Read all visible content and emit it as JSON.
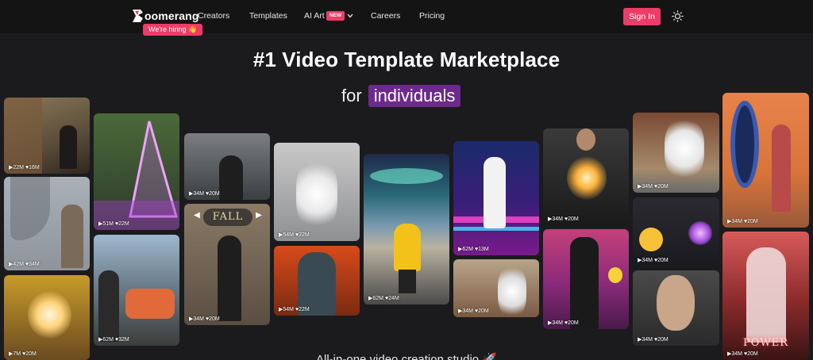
{
  "brand": {
    "name": "oomerang",
    "hiring_label": "We're hiring 👋"
  },
  "nav": {
    "creators": "Creators",
    "templates": "Templates",
    "ai_art": "AI Art",
    "ai_art_badge": "NEW",
    "careers": "Careers",
    "pricing": "Pricing",
    "sign_in": "Sign In"
  },
  "icons": {
    "logo": "boomerang-logo-icon",
    "ai_art_dropdown": "chevron-down-icon",
    "theme_toggle": "sun-icon",
    "play": "play-icon",
    "heart": "heart-icon",
    "carousel_prev": "chevron-left-icon",
    "carousel_next": "chevron-right-icon"
  },
  "hero": {
    "title": "#1 Video Template Marketplace",
    "sub_prefix": "for",
    "sub_highlight": "individuals",
    "tagline": "All-in-one video creation studio 🚀"
  },
  "colors": {
    "accent": "#ef3b67",
    "highlight": "#6d2a8c",
    "background": "#1b1b1d"
  },
  "cards": [
    {
      "views": "22M",
      "likes": "16M"
    },
    {
      "views": "42M",
      "likes": "34M"
    },
    {
      "views": "7M",
      "likes": "20M"
    },
    {
      "views": "51M",
      "likes": "22M"
    },
    {
      "views": "62M",
      "likes": "32M"
    },
    {
      "views": "34M",
      "likes": "20M"
    },
    {
      "label": "FALL",
      "views": "34M",
      "likes": "20M"
    },
    {
      "views": "54M",
      "likes": "22M"
    },
    {
      "views": "54M",
      "likes": "22M"
    },
    {
      "views": "62M",
      "likes": "24M"
    },
    {
      "views": "62M",
      "likes": "13M"
    },
    {
      "views": "34M",
      "likes": "20M"
    },
    {
      "views": "34M",
      "likes": "20M"
    },
    {
      "views": "34M",
      "likes": "20M"
    },
    {
      "views": "34M",
      "likes": "20M"
    },
    {
      "views": "34M",
      "likes": "20M"
    },
    {
      "views": "34M",
      "likes": "20M"
    },
    {
      "views": "34M",
      "likes": "20M"
    },
    {
      "label": "POWER",
      "views": "34M",
      "likes": "20M"
    }
  ]
}
